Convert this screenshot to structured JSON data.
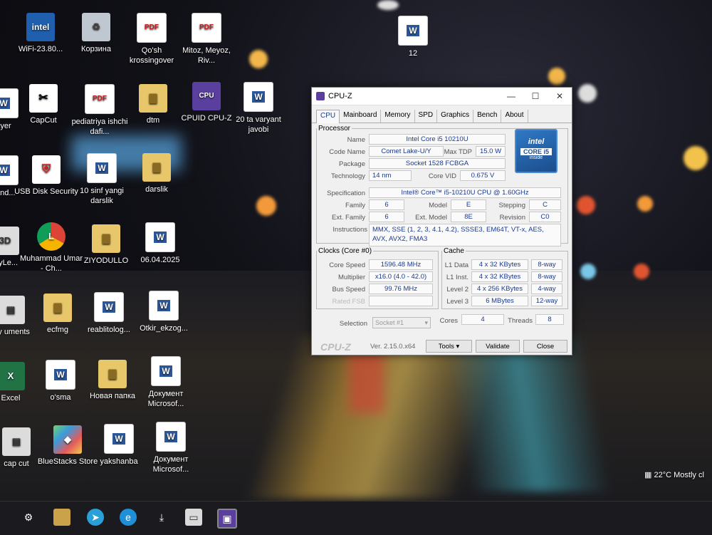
{
  "desktop_icons": {
    "wifi": "WiFi-23.80...",
    "recycle": "Корзина",
    "pdf_qosh": "Qo'sh krossingover",
    "pdf_mitoz": "Mitoz, Meyoz, Riv...",
    "word_12": "12",
    "layer": "ayer",
    "capcut": "CapCut",
    "pediatriya": "pediatriya ishchi dafi...",
    "dtm": "dtm",
    "cpuz": "CPUID CPU-Z",
    "variant": "20 ta varyant javobi",
    "usb": "USB Disk Security",
    "sinf": "10 sinf yangi darslik",
    "darslik": "darslik",
    "and": "l and...",
    "chrome": "Muhammad Umar - Ch...",
    "ziyodullo": "ZIYODULLO",
    "date_doc": "06.04.2025",
    "myle": "myLe...",
    "my_docs": "my uments",
    "ecfmg": "ecfmg",
    "reablitolog": "reablitolog...",
    "otkir": "Otkir_ekzog...",
    "excel": "Excel",
    "osma": "o'sma",
    "new_folder": "Новая папка",
    "doc_ms1": "Документ Microsof...",
    "capcut2": "cap cut",
    "bluestacks": "BlueStacks Store",
    "yakshanba": "yakshanba",
    "doc_ms2": "Документ Microsof..."
  },
  "cpuz": {
    "title": "CPU-Z",
    "tabs": [
      "CPU",
      "Mainboard",
      "Memory",
      "SPD",
      "Graphics",
      "Bench",
      "About"
    ],
    "processor": {
      "legend": "Processor",
      "name_label": "Name",
      "name": "Intel Core i5 10210U",
      "codename_label": "Code Name",
      "codename": "Comet Lake-U/Y",
      "maxtdp_label": "Max TDP",
      "maxtdp": "15.0 W",
      "package_label": "Package",
      "package": "Socket 1528 FCBGA",
      "technology_label": "Technology",
      "technology": "14 nm",
      "corevid_label": "Core VID",
      "corevid": "0.675 V",
      "spec_label": "Specification",
      "spec": "Intel® Core™ i5-10210U CPU @ 1.60GHz",
      "family_label": "Family",
      "family": "6",
      "model_label": "Model",
      "model": "E",
      "stepping_label": "Stepping",
      "stepping": "C",
      "extfamily_label": "Ext. Family",
      "extfamily": "6",
      "extmodel_label": "Ext. Model",
      "extmodel": "8E",
      "revision_label": "Revision",
      "revision": "C0",
      "instructions_label": "Instructions",
      "instructions": "MMX, SSE (1, 2, 3, 4.1, 4.2), SSSE3, EM64T, VT-x, AES, AVX, AVX2, FMA3",
      "logo_top": "intel",
      "logo_bottom": "CORE i5",
      "logo_small": "inside"
    },
    "clocks": {
      "legend": "Clocks (Core #0)",
      "corespeed_label": "Core Speed",
      "corespeed": "1596.48 MHz",
      "multiplier_label": "Multiplier",
      "multiplier": "x16.0 (4.0 - 42.0)",
      "busspeed_label": "Bus Speed",
      "busspeed": "99.76 MHz",
      "ratedfsb_label": "Rated FSB"
    },
    "cache": {
      "legend": "Cache",
      "l1data_label": "L1 Data",
      "l1data": "4 x 32 KBytes",
      "l1data_way": "8-way",
      "l1inst_label": "L1 Inst.",
      "l1inst": "4 x 32 KBytes",
      "l1inst_way": "8-way",
      "l2_label": "Level 2",
      "l2": "4 x 256 KBytes",
      "l2_way": "4-way",
      "l3_label": "Level 3",
      "l3": "6 MBytes",
      "l3_way": "12-way"
    },
    "selection_label": "Selection",
    "selection": "Socket #1",
    "cores_label": "Cores",
    "cores": "4",
    "threads_label": "Threads",
    "threads": "8",
    "brand": "CPU-Z",
    "version": "Ver. 2.15.0.x64",
    "tools": "Tools",
    "validate": "Validate",
    "close": "Close"
  },
  "weather": "22°C  Mostly cl"
}
